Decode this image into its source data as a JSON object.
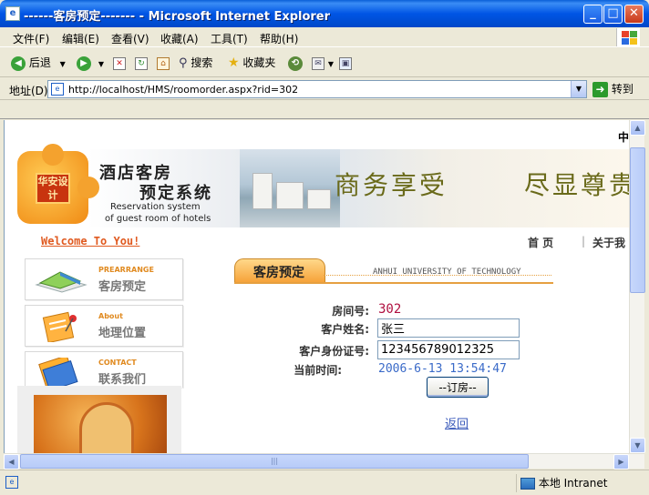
{
  "window": {
    "title": "------客房预定------- - Microsoft Internet Explorer",
    "icon": "ie-page-icon",
    "controls": {
      "minimize": "_",
      "maximize": "□",
      "close": "✕"
    }
  },
  "menubar": {
    "items": [
      "文件(F)",
      "编辑(E)",
      "查看(V)",
      "收藏(A)",
      "工具(T)",
      "帮助(H)"
    ]
  },
  "toolbar": {
    "back_label": "后退",
    "search_label": "搜索",
    "favorites_label": "收藏夹"
  },
  "address": {
    "label": "地址(D)",
    "url": "http://localhost/HMS/roomorder.aspx?rid=302",
    "go_label": "转到"
  },
  "statusbar": {
    "zone_label": "本地 Intranet"
  },
  "page": {
    "lang_char": "中",
    "banner": {
      "logo_seal": "华安设计",
      "title_cn_1": "酒店客房",
      "title_cn_2": "预定系统",
      "title_en_1": "Reservation system",
      "title_en_2": "of guest room of hotels",
      "slogan_1": "商务享受",
      "slogan_2": "尽显尊贵"
    },
    "welcome": "Welcome To You!",
    "topnav": {
      "home": "首 页",
      "separator": "|",
      "about": "关于我"
    },
    "sidebar": [
      {
        "en": "PREARRANGE",
        "cn": "客房预定"
      },
      {
        "en": "About",
        "cn": "地理位置"
      },
      {
        "en": "CONTACT",
        "cn": "联系我们"
      }
    ],
    "section": {
      "tab_label": "客房预定",
      "university": "ANHUI UNIVERSITY OF TECHNOLOGY"
    },
    "form": {
      "room_label": "房间号:",
      "room_value": "302",
      "name_label": "客户姓名:",
      "name_value": "张三",
      "id_label": "客户身份证号:",
      "id_value": "123456789012325",
      "time_label": "当前时间:",
      "time_value": "2006-6-13 13:54:47",
      "submit_label": "--订房--",
      "back_label": "返回"
    }
  }
}
